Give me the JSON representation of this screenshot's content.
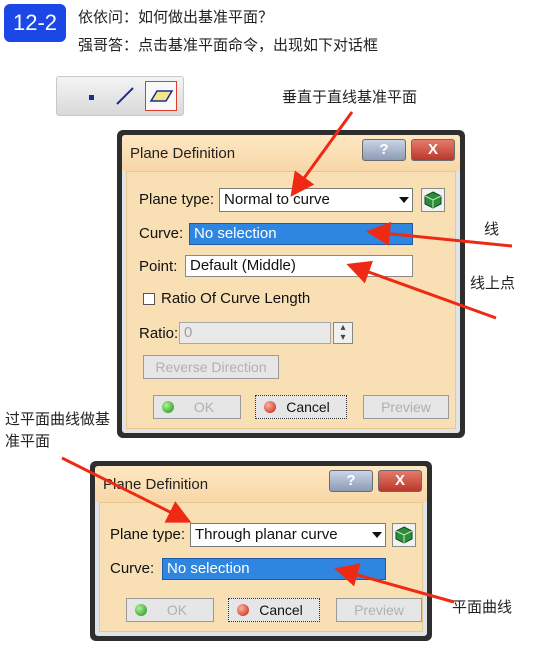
{
  "header": {
    "badge": "12-2",
    "question": "依依问：如何做出基准平面？",
    "answer": "强哥答：点击基准平面命令，出现如下对话框"
  },
  "toolbar": {
    "icons": [
      "point-icon",
      "line-icon",
      "plane-icon"
    ]
  },
  "annotations": {
    "normal_to_curve": "垂直于直线基准平面",
    "line": "线",
    "point_on_line": "线上点",
    "through_planar_curve": "过平面曲线做基准平面",
    "planar_curve": "平面曲线"
  },
  "dialog1": {
    "title": "Plane Definition",
    "help": "?",
    "close": "X",
    "plane_type_label": "Plane type:",
    "plane_type_value": "Normal to curve",
    "curve_label": "Curve:",
    "curve_value": "No selection",
    "point_label": "Point:",
    "point_value": "Default (Middle)",
    "ratio_checkbox_label": "Ratio Of Curve Length",
    "ratio_label": "Ratio:",
    "ratio_value": "0",
    "reverse_button": "Reverse Direction",
    "ok_button": "OK",
    "cancel_button": "Cancel",
    "preview_button": "Preview"
  },
  "dialog2": {
    "title": "Plane Definition",
    "help": "?",
    "close": "X",
    "plane_type_label": "Plane type:",
    "plane_type_value": "Through planar curve",
    "curve_label": "Curve:",
    "curve_value": "No selection",
    "ok_button": "OK",
    "cancel_button": "Cancel",
    "preview_button": "Preview"
  },
  "colors": {
    "badge": "#1a47e6",
    "arrow": "#ee2a14",
    "dialog_body": "#f8dfb4",
    "selection": "#2f86e0"
  }
}
